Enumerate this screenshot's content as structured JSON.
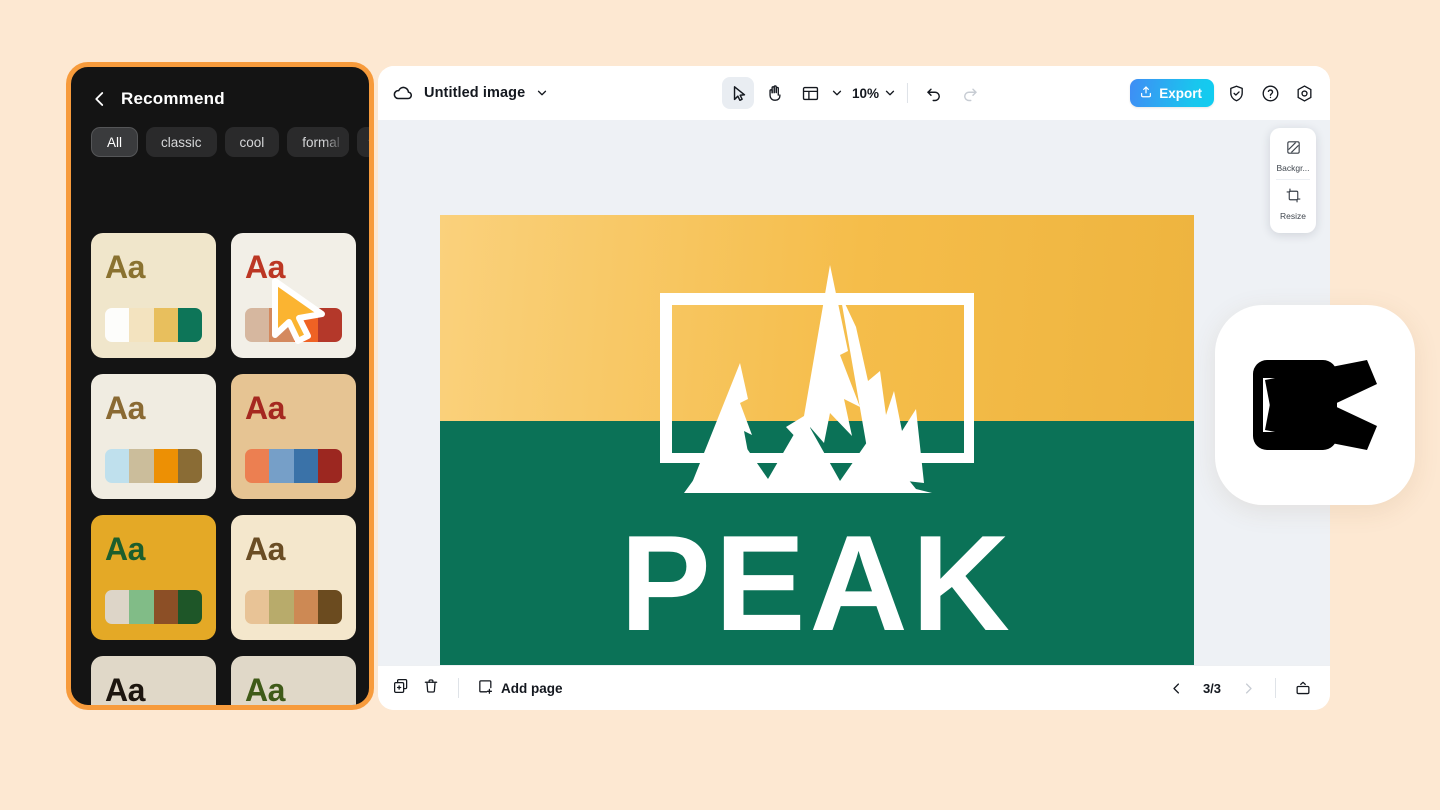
{
  "theme": {
    "page_background": "#FDE8D2",
    "accent_orange": "#F79B3C",
    "sidebar_background": "#141414",
    "canvas_background": "#eef1f5",
    "export_gradient_start": "#3f8df5",
    "export_gradient_end": "#10cdf0"
  },
  "toolbar": {
    "cloud_icon": "cloud-icon",
    "document_title": "Untitled image",
    "title_chevron_icon": "chevron-down-icon",
    "tools": [
      {
        "name": "select-tool",
        "icon": "cursor-arrow-icon",
        "active": true
      },
      {
        "name": "hand-tool",
        "icon": "hand-icon",
        "active": false
      },
      {
        "name": "layout-tool",
        "icon": "layout-grid-icon",
        "active": false
      }
    ],
    "layout_chevron_icon": "chevron-down-icon",
    "zoom_level": "10%",
    "zoom_chevron_icon": "chevron-down-icon",
    "undo_icon": "undo-arrow-icon",
    "redo_icon": "redo-arrow-icon",
    "undo_enabled": true,
    "redo_enabled": false,
    "export_label": "Export",
    "export_icon": "upload-icon",
    "shield_icon": "shield-check-icon",
    "help_icon": "question-circle-icon",
    "settings_icon": "gear-icon"
  },
  "float_panel": {
    "items": [
      {
        "name": "background-button",
        "label": "Backgr...",
        "icon": "background-swatch-icon"
      },
      {
        "name": "resize-button",
        "label": "Resize",
        "icon": "resize-crop-icon"
      }
    ]
  },
  "artboard": {
    "sky_color": "#f5bd4a",
    "ground_color": "#0b7257",
    "logo_color": "#ffffff",
    "wordmark": "PEAK",
    "logo_name": "mountain-frame-logo"
  },
  "bottombar": {
    "duplicate_icon": "duplicate-page-icon",
    "delete_icon": "trash-icon",
    "add_page_icon": "add-page-icon",
    "add_page_label": "Add page",
    "prev_icon": "chevron-left-icon",
    "next_icon": "chevron-right-icon",
    "prev_enabled": true,
    "next_enabled": false,
    "page_indicator": "3/3",
    "panel_toggle_icon": "page-panel-icon"
  },
  "sidebar": {
    "back_icon": "chevron-left-icon",
    "title": "Recommend",
    "more_icon": "chevron-down-icon",
    "chips": [
      {
        "label": "All",
        "selected": true
      },
      {
        "label": "classic",
        "selected": false
      },
      {
        "label": "cool",
        "selected": false
      },
      {
        "label": "formal",
        "selected": false
      }
    ],
    "cards": [
      {
        "name": "theme-card-1",
        "sample_text": "Aa",
        "background": "#f0e6cb",
        "text_color": "#8a7230",
        "swatches": [
          "#fdfdfb",
          "#f3e3bf",
          "#e8bf5d",
          "#0d7558"
        ]
      },
      {
        "name": "theme-card-2",
        "sample_text": "Aa",
        "background": "#f2efe7",
        "text_color": "#bc3724",
        "swatches": [
          "#d6b79f",
          "#d4895e",
          "#ef6224",
          "#b4382a"
        ]
      },
      {
        "name": "theme-card-3",
        "sample_text": "Aa",
        "background": "#f0ece1",
        "text_color": "#8a6a33",
        "swatches": [
          "#bfe0ed",
          "#cbbd9b",
          "#ed9004",
          "#8a6c35"
        ]
      },
      {
        "name": "theme-card-4",
        "sample_text": "Aa",
        "background": "#e6c493",
        "text_color": "#a52820",
        "swatches": [
          "#ec7f51",
          "#769fc8",
          "#3a72a8",
          "#9c2720"
        ]
      },
      {
        "name": "theme-card-5",
        "sample_text": "Aa",
        "background": "#e4a926",
        "text_color": "#1d5e2c",
        "swatches": [
          "#ddd5c8",
          "#81bc87",
          "#8c4f26",
          "#1e5628"
        ]
      },
      {
        "name": "theme-card-6",
        "sample_text": "Aa",
        "background": "#f4e7cc",
        "text_color": "#6a4d24",
        "swatches": [
          "#e8c396",
          "#b8ab6b",
          "#cd8954",
          "#6b4b1f"
        ]
      },
      {
        "name": "theme-card-7",
        "sample_text": "Aa",
        "background": "#e0d8c8",
        "text_color": "#1d160f",
        "swatches": [
          "#f7a24a",
          "#bda283",
          "#8a5a2c",
          "#1f140e"
        ]
      },
      {
        "name": "theme-card-8",
        "sample_text": "Aa",
        "background": "#e0d8c8",
        "text_color": "#3f5a18",
        "swatches": [
          "#b2b389",
          "#9aa95c",
          "#6f8f20",
          "#3c5210"
        ]
      }
    ]
  },
  "cursor": {
    "name": "pointer-cursor",
    "color": "#FBB431"
  },
  "badge": {
    "name": "capcut-logo",
    "color": "#000000"
  }
}
